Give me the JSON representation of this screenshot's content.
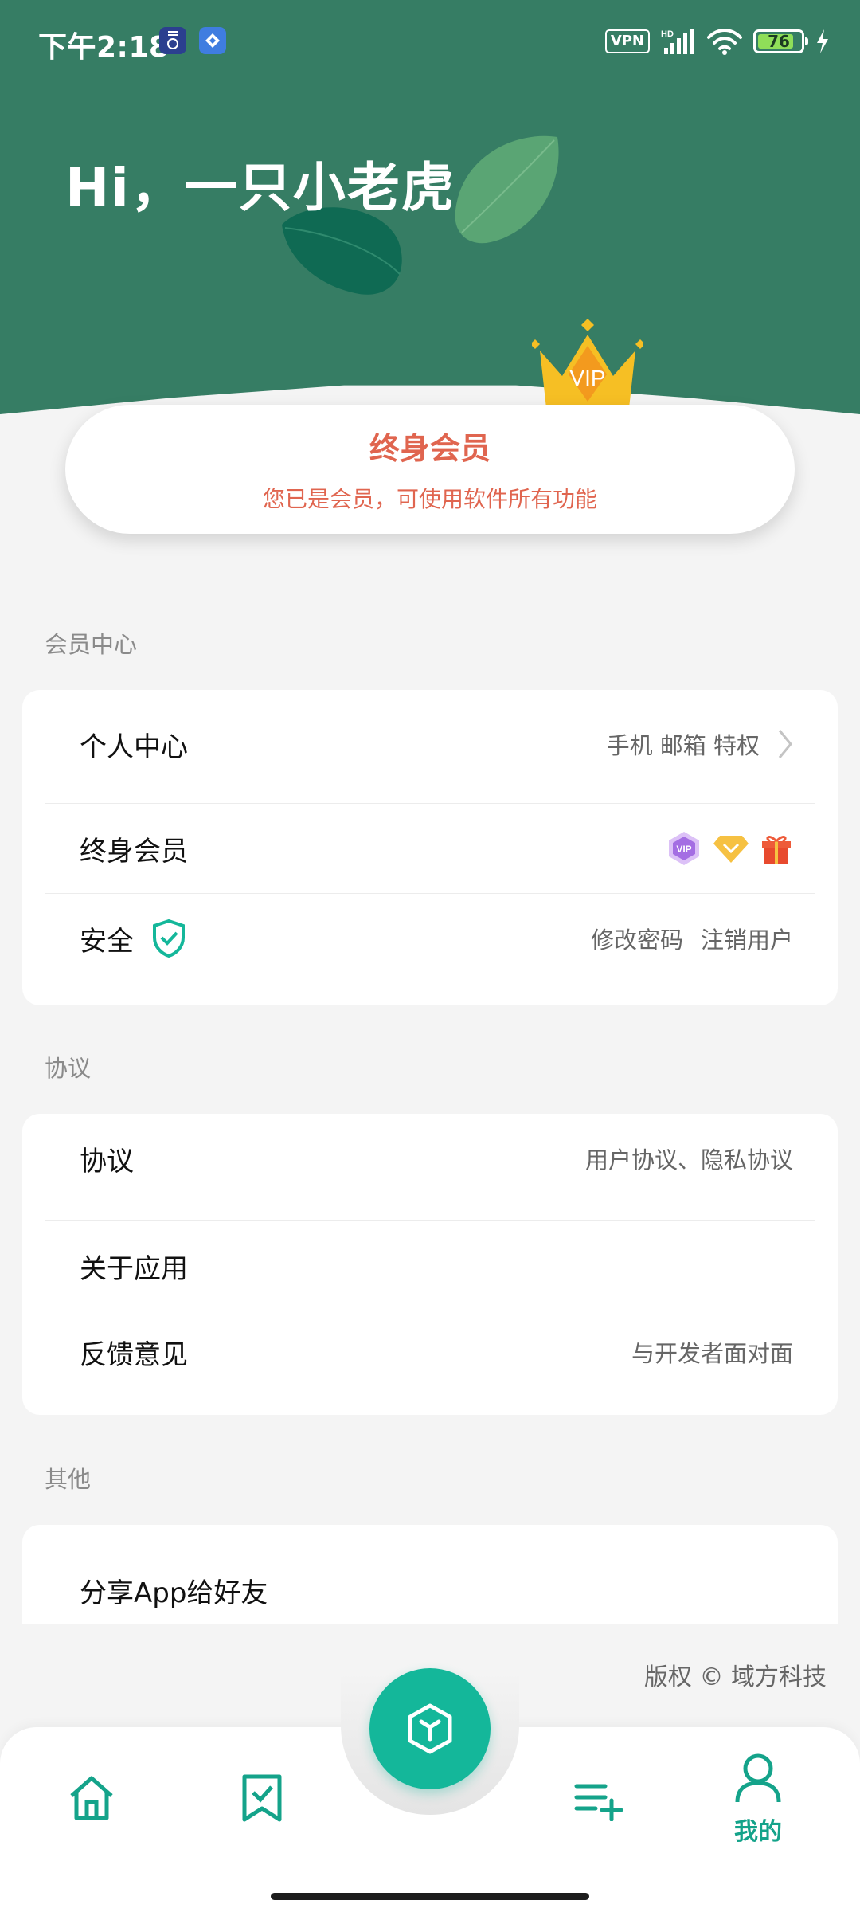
{
  "status_bar": {
    "time": "下午2:18",
    "vpn": "VPN",
    "network": "HD",
    "battery": "76",
    "icons": [
      "app-notification-icon",
      "app-notification-icon-2",
      "signal-icon",
      "wifi-icon",
      "battery-icon",
      "charging-icon"
    ]
  },
  "header": {
    "greeting": "Hi，一只小老虎",
    "crown_badge": "VIP"
  },
  "membership": {
    "title": "终身会员",
    "subtitle": "您已是会员，可使用软件所有功能"
  },
  "sections": {
    "member_center": {
      "label": "会员中心",
      "rows": [
        {
          "title": "个人中心",
          "right": "手机 邮箱 特权"
        },
        {
          "title": "终身会员",
          "badges": [
            "VIP",
            "diamond",
            "gift"
          ]
        },
        {
          "title": "安全",
          "right_a": "修改密码",
          "right_b": "注销用户"
        }
      ]
    },
    "agreements": {
      "label": "协议",
      "rows": [
        {
          "title": "协议",
          "right": "用户协议、隐私协议"
        },
        {
          "title": "关于应用",
          "right": ""
        },
        {
          "title": "反馈意见",
          "right": "与开发者面对面"
        }
      ]
    },
    "other": {
      "label": "其他",
      "rows": [
        {
          "title": "分享App给好友"
        }
      ]
    }
  },
  "footer": {
    "copyright": "版权 © 域方科技"
  },
  "bottom_nav": {
    "items": [
      {
        "icon": "home-icon",
        "label": ""
      },
      {
        "icon": "bookmark-check-icon",
        "label": ""
      },
      {
        "icon": "cube-icon",
        "label": ""
      },
      {
        "icon": "playlist-add-icon",
        "label": ""
      },
      {
        "icon": "person-icon",
        "label": "我的"
      }
    ],
    "active_index": 4
  },
  "colors": {
    "header": "#367d64",
    "accent": "#14b79a",
    "member_text": "#e0654f"
  }
}
